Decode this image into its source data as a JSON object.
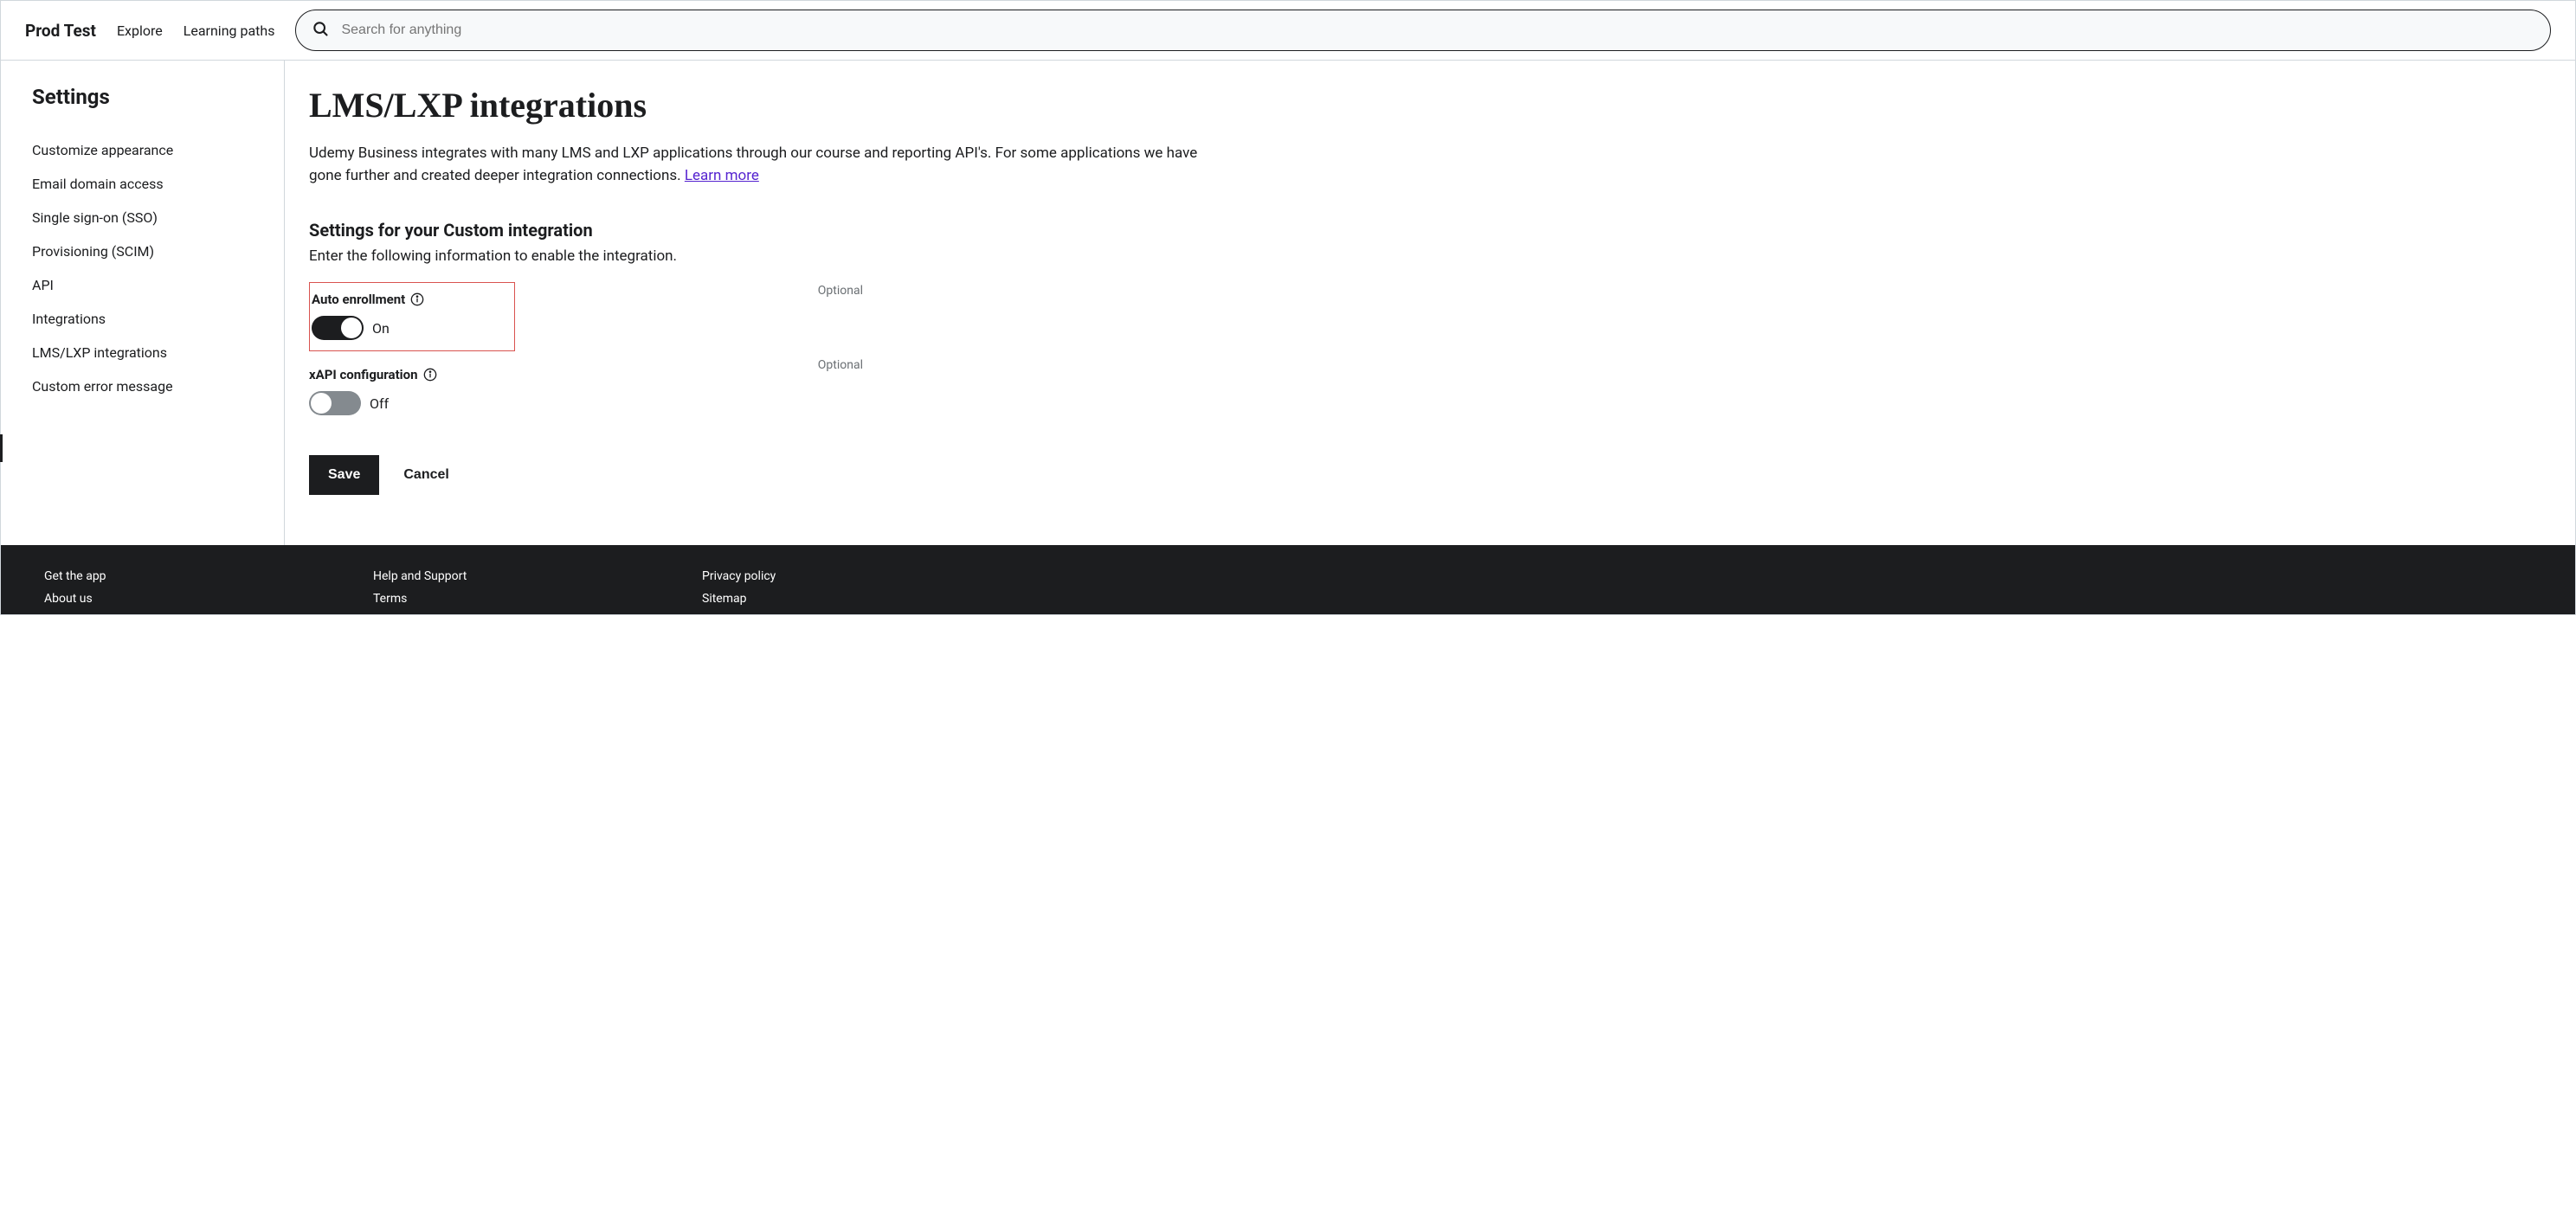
{
  "header": {
    "brand": "Prod Test",
    "nav": {
      "explore": "Explore",
      "learning_paths": "Learning paths"
    },
    "search_placeholder": "Search for anything"
  },
  "sidebar": {
    "title": "Settings",
    "items": [
      "Customize appearance",
      "Email domain access",
      "Single sign-on (SSO)",
      "Provisioning (SCIM)",
      "API",
      "Integrations",
      "LMS/LXP integrations",
      "Custom error message"
    ]
  },
  "main": {
    "title": "LMS/LXP integrations",
    "description_part1": "Udemy Business integrates with many LMS and LXP applications through our course and reporting API's. For some applications we have gone further and created deeper integration connections. ",
    "learn_more": "Learn more",
    "section_title": "Settings for your Custom integration",
    "section_sub": "Enter the following information to enable the integration.",
    "auto_enrollment": {
      "label": "Auto enrollment",
      "state": "On",
      "optional": "Optional"
    },
    "xapi": {
      "label": "xAPI configuration",
      "state": "Off",
      "optional": "Optional"
    },
    "save": "Save",
    "cancel": "Cancel"
  },
  "footer": {
    "col1": [
      "Get the app",
      "About us"
    ],
    "col2": [
      "Help and Support",
      "Terms"
    ],
    "col3": [
      "Privacy policy",
      "Sitemap"
    ]
  }
}
